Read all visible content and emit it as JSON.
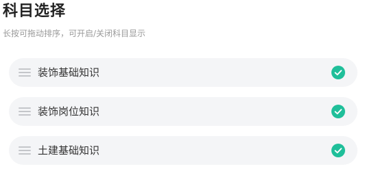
{
  "header": {
    "title": "科目选择",
    "subtitle": "长按可拖动排序，可开启/关闭科目显示"
  },
  "subjects": [
    {
      "label": "装饰基础知识",
      "enabled": true,
      "drag_icon": "drag-handle-icon",
      "check_icon": "check-circle-icon"
    },
    {
      "label": "装饰岗位知识",
      "enabled": true,
      "drag_icon": "drag-handle-icon",
      "check_icon": "check-circle-icon"
    },
    {
      "label": "土建基础知识",
      "enabled": true,
      "drag_icon": "drag-handle-icon",
      "check_icon": "check-circle-icon"
    }
  ],
  "colors": {
    "accent": "#1fbf9a",
    "item_background": "#f4f5f7",
    "title": "#222222",
    "subtitle": "#9a9a9a",
    "drag_handle": "#c4c6ca"
  }
}
